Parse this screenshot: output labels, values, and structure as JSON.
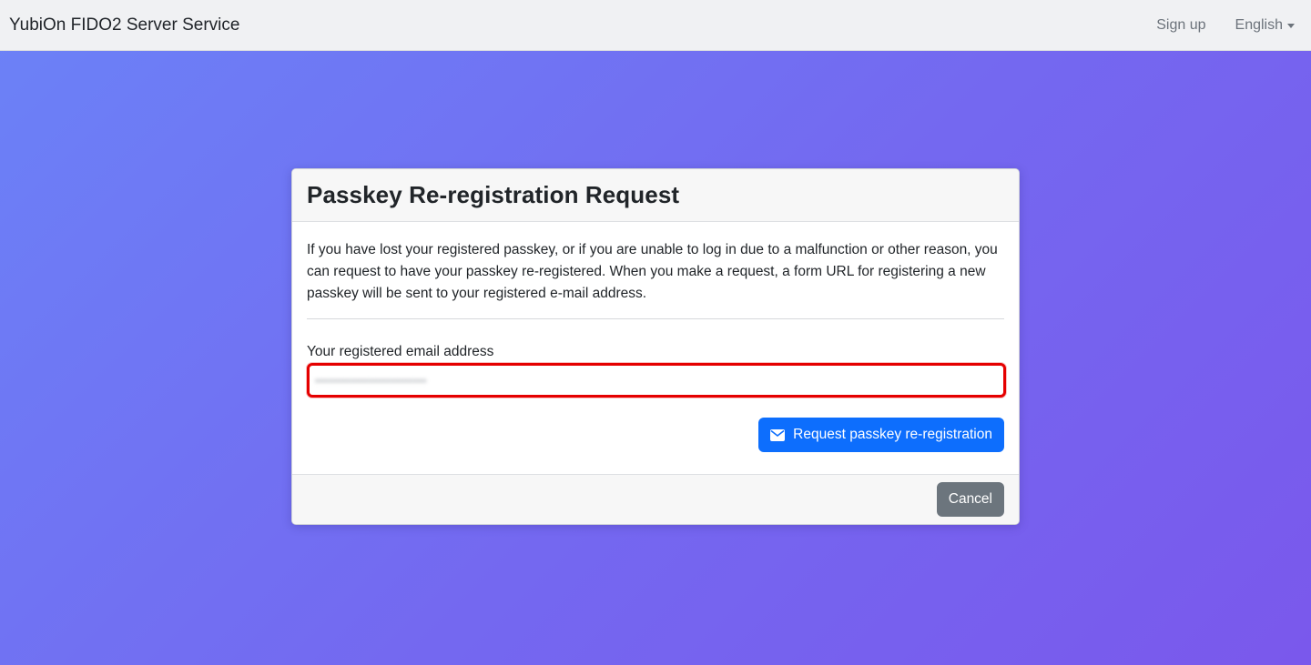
{
  "navbar": {
    "brand": "YubiOn FIDO2 Server Service",
    "signup_label": "Sign up",
    "language_label": "English"
  },
  "card": {
    "title": "Passkey Re-registration Request",
    "description": "If you have lost your registered passkey, or if you are unable to log in due to a malfunction or other reason, you can request to have your passkey re-registered. When you make a request, a form URL for registering a new passkey will be sent to your registered e-mail address.",
    "email_label": "Your registered email address",
    "email_value": "",
    "email_blurred_text": "•••••••••••••••••••••••••",
    "request_button_label": "Request passkey re-registration",
    "cancel_button_label": "Cancel"
  },
  "colors": {
    "primary": "#0d6efd",
    "secondary": "#6c757d",
    "highlight": "#e50000",
    "gradient_start": "#6b82f7",
    "gradient_end": "#7a58ec"
  },
  "icons": {
    "request_button_icon": "envelope-icon",
    "language_caret": "caret-down-icon"
  }
}
